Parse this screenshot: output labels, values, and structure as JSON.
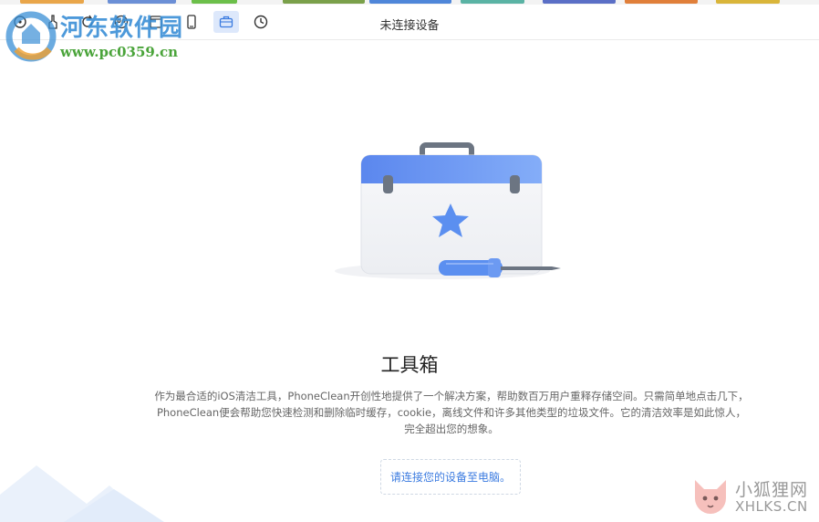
{
  "toolbar": {
    "device_status": "未连接设备",
    "buttons": [
      {
        "name": "device-home-icon"
      },
      {
        "name": "clean-icon"
      },
      {
        "name": "refresh-icon"
      },
      {
        "name": "privacy-icon"
      },
      {
        "name": "photo-icon"
      },
      {
        "name": "phone-icon"
      },
      {
        "name": "toolbox-icon",
        "active": true
      },
      {
        "name": "history-icon"
      }
    ]
  },
  "watermark": {
    "site_name": "河东软件园",
    "site_url": "www.pc0359.cn"
  },
  "main": {
    "headline": "工具箱",
    "description_lines": [
      "作为最合适的iOS清洁工具，PhoneClean开创性地提供了一个解决方案，帮助数百万用户重释存储空间。只需简单地点击几下，",
      "PhoneClean便会帮助您快速检测和删除临时缓存，cookie，离线文件和许多其他类型的垃圾文件。它的清洁效率是如此惊人，",
      "完全超出您的想象。"
    ],
    "connect_hint": "请连接您的设备至电脑。"
  },
  "corner_watermark": {
    "name_cn": "小狐狸网",
    "name_en": "XHLKS.CN"
  },
  "colors": {
    "accent": "#3b7be0",
    "toolbox_lid": "#6f9ef5",
    "toolbox_body": "#f4f5f8",
    "active_tab_bg": "#dde8fb"
  }
}
